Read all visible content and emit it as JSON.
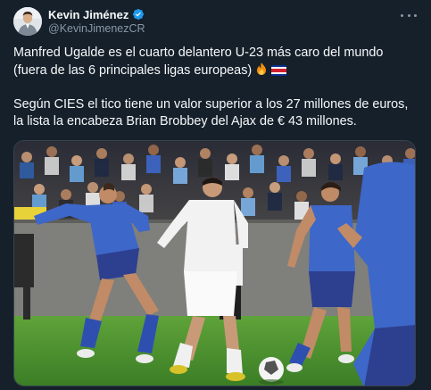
{
  "author": {
    "display_name": "Kevin Jiménez",
    "handle": "@KevinJimenezCR",
    "verified": true,
    "avatar_icon": "profile-photo"
  },
  "tweet": {
    "line1": "Manfred Ugalde es el cuarto delantero U-23 más caro del mundo (fuera de las 6 principales ligas europeas)",
    "line1_icons": [
      "fire-emoji",
      "costa-rica-flag-emoji"
    ],
    "line2": "Según CIES el tico tiene un valor superior a los 27 millones de euros, la lista la encabeza Brian Brobbey del Ajax de € 43 millones."
  },
  "media": {
    "description_icon": "football-match-photo",
    "team_colors": {
      "argentina_shirt": "#3d67c9",
      "costa_rica_shirt": "#f2f2f2",
      "pitch": "#3f8a2b"
    }
  },
  "colors": {
    "background": "#15202b",
    "text_primary": "#f7f9f9",
    "text_secondary": "#8b98a5",
    "verified_badge": "#1d9bf0",
    "border": "#38444d"
  }
}
